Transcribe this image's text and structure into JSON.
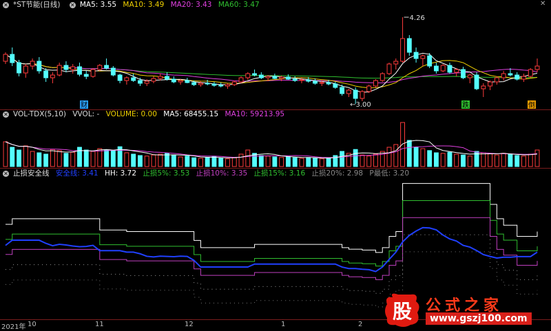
{
  "colors": {
    "up": "#ff3b3b",
    "down": "#54ffff",
    "ma5": "#ffffff",
    "ma10": "#f0d000",
    "ma20": "#e040e0",
    "ma60": "#30c030",
    "hh": "#ffffff",
    "zs5": "#30c030",
    "zs10": "#c040c0",
    "zs15": "#30c030",
    "zs20": "#aaaaaa",
    "line": "#2040ff"
  },
  "main_header": {
    "title": "*ST节能(日线)",
    "ma5": "MA5: 3.55",
    "ma10": "MA10: 3.49",
    "ma20": "MA20: 3.43",
    "ma60": "MA60: 3.47"
  },
  "vol_header": {
    "title": "VOL-TDX(5,10)",
    "vvol": "VVOL: -",
    "volume": "VOLUME: 0.00",
    "ma5": "MA5: 68455.15",
    "ma10": "MA10: 59213.95"
  },
  "ind_header": {
    "title": "止损安全线",
    "label": "安全线: 3.41",
    "hh": "HH: 3.72",
    "zs5": "止损5%: 3.53",
    "zs10": "止损10%: 3.35",
    "zs15": "止损15%: 3.16",
    "zs20": "止损20%: 2.98",
    "pmin": "P最低: 3.20"
  },
  "annotations": {
    "high": "4.26",
    "low": "3.00",
    "marker_cai": "财",
    "marker_die": "跌",
    "marker_dao": "倒"
  },
  "x_axis": [
    "2021年",
    "10",
    "11",
    "12",
    "1",
    "2"
  ],
  "logo": {
    "seal_char": "股",
    "brand": "公式之家",
    "site": "www.gszj100.com"
  },
  "chart_data": {
    "type": "candlestick",
    "candles": [
      [
        3.62,
        3.75,
        3.58,
        3.72
      ],
      [
        3.72,
        3.82,
        3.55,
        3.6
      ],
      [
        3.6,
        3.64,
        3.4,
        3.45
      ],
      [
        3.45,
        3.58,
        3.38,
        3.55
      ],
      [
        3.55,
        3.66,
        3.5,
        3.62
      ],
      [
        3.62,
        3.68,
        3.44,
        3.48
      ],
      [
        3.48,
        3.52,
        3.32,
        3.38
      ],
      [
        3.38,
        3.46,
        3.3,
        3.42
      ],
      [
        3.42,
        3.6,
        3.4,
        3.56
      ],
      [
        3.56,
        3.62,
        3.46,
        3.5
      ],
      [
        3.5,
        3.58,
        3.44,
        3.54
      ],
      [
        3.54,
        3.6,
        3.4,
        3.43
      ],
      [
        3.43,
        3.48,
        3.36,
        3.4
      ],
      [
        3.4,
        3.52,
        3.38,
        3.5
      ],
      [
        3.5,
        3.58,
        3.48,
        3.56
      ],
      [
        3.56,
        3.66,
        3.5,
        3.52
      ],
      [
        3.52,
        3.55,
        3.4,
        3.42
      ],
      [
        3.42,
        3.44,
        3.3,
        3.34
      ],
      [
        3.34,
        3.4,
        3.28,
        3.38
      ],
      [
        3.38,
        3.44,
        3.32,
        3.34
      ],
      [
        3.34,
        3.38,
        3.26,
        3.3
      ],
      [
        3.3,
        3.36,
        3.26,
        3.33
      ],
      [
        3.33,
        3.4,
        3.3,
        3.37
      ],
      [
        3.37,
        3.44,
        3.34,
        3.4
      ],
      [
        3.4,
        3.46,
        3.34,
        3.36
      ],
      [
        3.36,
        3.4,
        3.3,
        3.32
      ],
      [
        3.32,
        3.36,
        3.28,
        3.34
      ],
      [
        3.34,
        3.38,
        3.3,
        3.31
      ],
      [
        3.31,
        3.34,
        3.26,
        3.28
      ],
      [
        3.28,
        3.33,
        3.25,
        3.3
      ],
      [
        3.3,
        3.35,
        3.27,
        3.29
      ],
      [
        3.29,
        3.32,
        3.25,
        3.27
      ],
      [
        3.27,
        3.31,
        3.24,
        3.26
      ],
      [
        3.26,
        3.3,
        3.22,
        3.28
      ],
      [
        3.28,
        3.34,
        3.26,
        3.32
      ],
      [
        3.32,
        3.4,
        3.3,
        3.38
      ],
      [
        3.38,
        3.46,
        3.35,
        3.44
      ],
      [
        3.44,
        3.5,
        3.4,
        3.42
      ],
      [
        3.42,
        3.46,
        3.36,
        3.38
      ],
      [
        3.38,
        3.42,
        3.33,
        3.4
      ],
      [
        3.4,
        3.44,
        3.36,
        3.37
      ],
      [
        3.37,
        3.41,
        3.33,
        3.39
      ],
      [
        3.39,
        3.43,
        3.35,
        3.36
      ],
      [
        3.36,
        3.4,
        3.32,
        3.34
      ],
      [
        3.34,
        3.38,
        3.3,
        3.35
      ],
      [
        3.35,
        3.39,
        3.31,
        3.33
      ],
      [
        3.33,
        3.37,
        3.28,
        3.3
      ],
      [
        3.3,
        3.34,
        3.26,
        3.31
      ],
      [
        3.31,
        3.35,
        3.27,
        3.29
      ],
      [
        3.29,
        3.32,
        3.22,
        3.24
      ],
      [
        3.24,
        3.28,
        3.12,
        3.15
      ],
      [
        3.15,
        3.22,
        3.1,
        3.2
      ],
      [
        3.2,
        3.24,
        3.0,
        3.08
      ],
      [
        3.08,
        3.2,
        3.04,
        3.18
      ],
      [
        3.18,
        3.28,
        3.16,
        3.26
      ],
      [
        3.26,
        3.36,
        3.24,
        3.34
      ],
      [
        3.34,
        3.46,
        3.32,
        3.44
      ],
      [
        3.44,
        3.6,
        3.42,
        3.58
      ],
      [
        3.58,
        3.66,
        3.5,
        3.62
      ],
      [
        3.62,
        4.26,
        3.6,
        3.95
      ],
      [
        3.95,
        4.0,
        3.7,
        3.75
      ],
      [
        3.75,
        3.82,
        3.6,
        3.66
      ],
      [
        3.66,
        3.72,
        3.55,
        3.7
      ],
      [
        3.7,
        3.74,
        3.52,
        3.55
      ],
      [
        3.55,
        3.6,
        3.44,
        3.48
      ],
      [
        3.48,
        3.58,
        3.46,
        3.56
      ],
      [
        3.56,
        3.6,
        3.44,
        3.46
      ],
      [
        3.46,
        3.52,
        3.4,
        3.5
      ],
      [
        3.5,
        3.54,
        3.36,
        3.38
      ],
      [
        3.38,
        3.44,
        3.3,
        3.42
      ],
      [
        3.42,
        3.46,
        3.2,
        3.22
      ],
      [
        3.22,
        3.3,
        3.1,
        3.26
      ],
      [
        3.26,
        3.34,
        3.2,
        3.32
      ],
      [
        3.32,
        3.4,
        3.28,
        3.38
      ],
      [
        3.38,
        3.48,
        3.34,
        3.44
      ],
      [
        3.44,
        3.52,
        3.4,
        3.42
      ],
      [
        3.42,
        3.46,
        3.34,
        3.36
      ],
      [
        3.36,
        3.44,
        3.32,
        3.4
      ],
      [
        3.4,
        3.52,
        3.38,
        3.5
      ],
      [
        3.5,
        3.66,
        3.46,
        3.55
      ]
    ],
    "volume": [
      90,
      70,
      60,
      75,
      55,
      50,
      45,
      62,
      58,
      48,
      52,
      70,
      60,
      55,
      65,
      60,
      58,
      72,
      50,
      45,
      40,
      38,
      42,
      45,
      48,
      40,
      35,
      38,
      32,
      30,
      34,
      36,
      30,
      28,
      32,
      45,
      60,
      48,
      40,
      38,
      35,
      33,
      36,
      32,
      30,
      33,
      30,
      28,
      32,
      40,
      55,
      48,
      62,
      42,
      38,
      45,
      55,
      70,
      80,
      160,
      95,
      70,
      65,
      58,
      50,
      48,
      52,
      45,
      42,
      38,
      55,
      50,
      46,
      42,
      48,
      44,
      40,
      38,
      45,
      60
    ],
    "ylim_price": [
      2.95,
      4.35
    ],
    "ylim_volume": [
      0,
      170
    ]
  }
}
